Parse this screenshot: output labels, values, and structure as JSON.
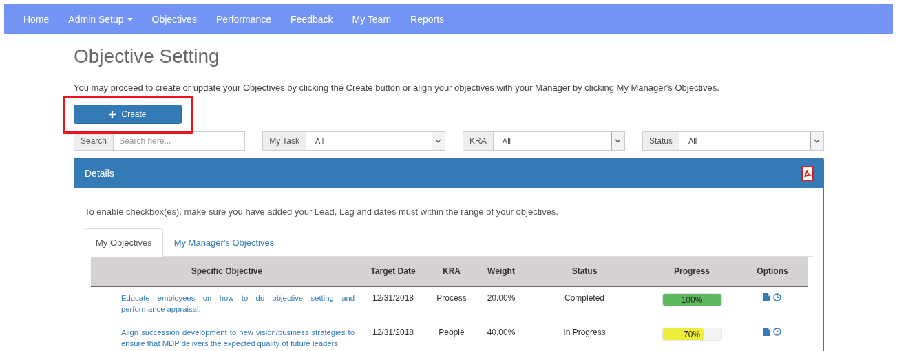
{
  "nav": [
    {
      "label": "Home",
      "dropdown": false
    },
    {
      "label": "Admin Setup",
      "dropdown": true
    },
    {
      "label": "Objectives",
      "dropdown": false
    },
    {
      "label": "Performance",
      "dropdown": false
    },
    {
      "label": "Feedback",
      "dropdown": false
    },
    {
      "label": "My Team",
      "dropdown": false
    },
    {
      "label": "Reports",
      "dropdown": false
    }
  ],
  "title": "Objective Setting",
  "intro": "You may proceed to create or update your Objectives by clicking the Create button or align your objectives with your Manager by clicking My Manager's Objectives.",
  "create_button": {
    "label": "Create",
    "highlighted": true
  },
  "search": {
    "label": "Search",
    "placeholder": "Search here..."
  },
  "filters": [
    {
      "label": "My Task",
      "value": "All"
    },
    {
      "label": "KRA",
      "value": "All"
    },
    {
      "label": "Status",
      "value": "All"
    }
  ],
  "panel": {
    "title": "Details",
    "note": "To enable checkbox(es), make sure you have added your Lead, Lag and dates must within the range of your objectives."
  },
  "tabs": [
    {
      "label": "My Objectives",
      "selected": true
    },
    {
      "label": "My Manager's Objectives",
      "selected": false
    }
  ],
  "table": {
    "columns": [
      "Specific Objective",
      "Target Date",
      "KRA",
      "Weight",
      "Status",
      "Progress",
      "Options"
    ],
    "rows": [
      {
        "objective": "Educate employees on how to do objective setting and performance appraisal.",
        "target_date": "12/31/2018",
        "kra": "Process",
        "weight": "20.00%",
        "status": "Completed",
        "progress": "100%",
        "level": 1,
        "color": "#5cb85c"
      },
      {
        "objective": "Align succession development to new vision/business strategies to ensure that MDP delivers the expected quality of future leaders.",
        "target_date": "12/31/2018",
        "kra": "People",
        "weight": "40.00%",
        "status": "In Progress",
        "progress": "70%",
        "level": 0.7,
        "color": "#f0ee3c"
      }
    ]
  }
}
